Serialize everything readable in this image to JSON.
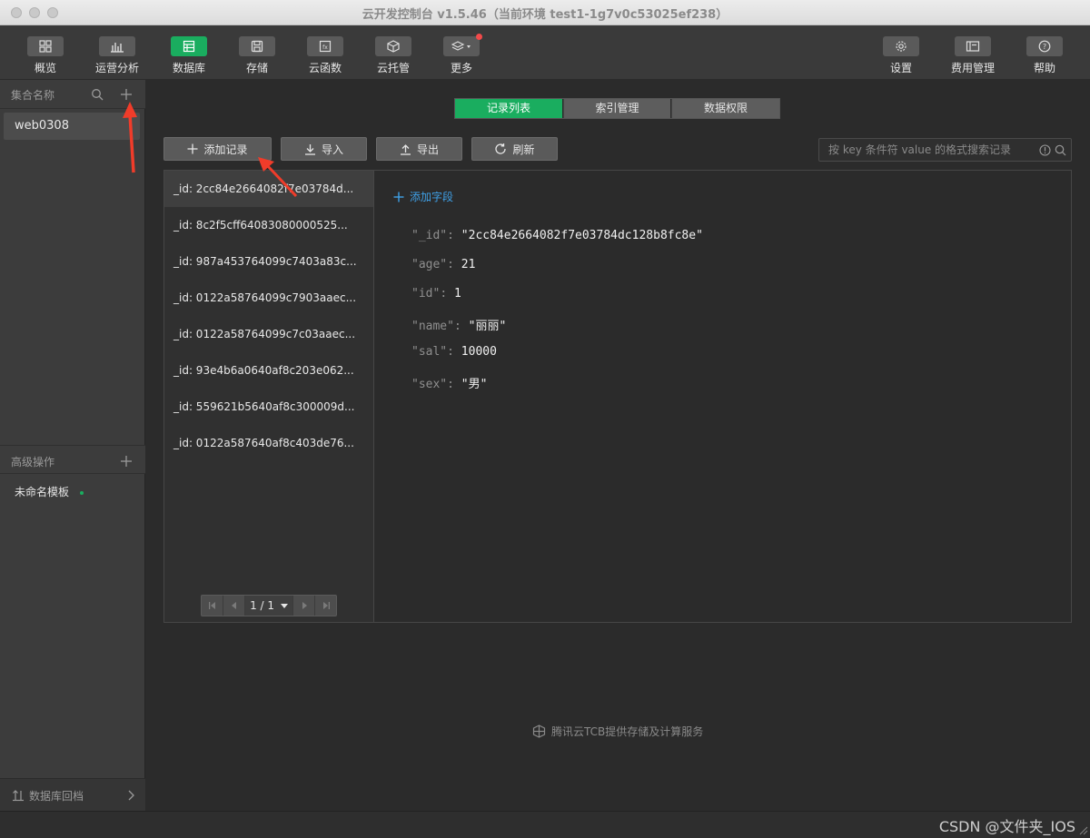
{
  "window": {
    "title": "云开发控制台 v1.5.46（当前环境 test1-1g7v0c53025ef238）"
  },
  "toolbar": {
    "items": [
      {
        "label": "概览",
        "icon": "grid-icon"
      },
      {
        "label": "运营分析",
        "icon": "bar-chart-icon"
      },
      {
        "label": "数据库",
        "icon": "database-icon",
        "active": true
      },
      {
        "label": "存储",
        "icon": "save-icon"
      },
      {
        "label": "云函数",
        "icon": "function-icon"
      },
      {
        "label": "云托管",
        "icon": "box-icon"
      },
      {
        "label": "更多",
        "icon": "layers-icon",
        "has_badge": true
      }
    ],
    "right_items": [
      {
        "label": "设置",
        "icon": "gear-icon"
      },
      {
        "label": "费用管理",
        "icon": "billing-icon"
      },
      {
        "label": "帮助",
        "icon": "help-icon"
      }
    ]
  },
  "sidebar": {
    "collections_header": "集合名称",
    "collections": [
      {
        "name": "web0308"
      }
    ],
    "advanced_header": "高级操作",
    "templates": [
      {
        "name": "未命名模板"
      }
    ],
    "rollback_label": "数据库回档"
  },
  "tabs": [
    {
      "label": "记录列表",
      "active": true
    },
    {
      "label": "索引管理"
    },
    {
      "label": "数据权限"
    }
  ],
  "actions": {
    "add_record": "添加记录",
    "import": "导入",
    "export": "导出",
    "refresh": "刷新"
  },
  "search": {
    "placeholder": "按 key 条件符 value 的格式搜索记录"
  },
  "records": [
    "_id: 2cc84e2664082f7e03784d...",
    "_id: 8c2f5cff64083080000525...",
    "_id: 987a453764099c7403a83c...",
    "_id: 0122a58764099c7903aaec...",
    "_id: 0122a58764099c7c03aaec...",
    "_id: 93e4b6a0640af8c203e062...",
    "_id: 559621b5640af8c300009d...",
    "_id: 0122a587640af8c403de76..."
  ],
  "pager": {
    "label": "1 / 1"
  },
  "detail": {
    "add_field": "添加字段",
    "fields": [
      {
        "key": "\"_id\"",
        "value": "\"2cc84e2664082f7e03784dc128b8fc8e\""
      },
      {
        "key": "\"age\"",
        "value": "21"
      },
      {
        "key": "\"id\"",
        "value": "1"
      },
      {
        "key": "\"name\"",
        "value": "\"丽丽\""
      },
      {
        "key": "\"sal\"",
        "value": "10000"
      },
      {
        "key": "\"sex\"",
        "value": "\"男\""
      }
    ]
  },
  "footer": {
    "provider": "腾讯云TCB提供存储及计算服务"
  },
  "watermark": "CSDN @文件夹_IOS",
  "colors": {
    "accent": "#1aad5f",
    "annotation": "#f03c2a"
  }
}
